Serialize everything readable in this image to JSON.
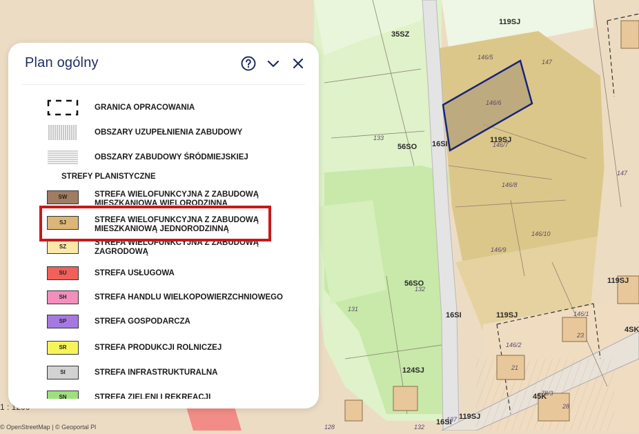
{
  "panel": {
    "title": "Plan ogólny",
    "help_icon": "help-circle-icon",
    "collapse_icon": "chevron-down-icon",
    "close_icon": "close-icon"
  },
  "legend": {
    "items": [
      {
        "label": "GRANICA OPRACOWANIA",
        "symbol": "dashed-boundary"
      },
      {
        "label": "OBSZARY UZUPEŁNIENIA ZABUDOWY",
        "symbol": "vertical-hatch"
      },
      {
        "label": "OBSZARY ZABUDOWY ŚRÓDMIEJSKIEJ",
        "symbol": "horizontal-hatch"
      }
    ],
    "section_header": "STREFY PLANISTYCZNE",
    "zones": [
      {
        "code": "SW",
        "label_line1": "STREFA WIELOFUNKCYJNA Z ZABUDOWĄ",
        "label_line2": "MIESZKANIOWĄ WIELORODZINNĄ",
        "color": "#a07c63"
      },
      {
        "code": "SJ",
        "label_line1": "STREFA WIELOFUNKCYJNA Z ZABUDOWĄ",
        "label_line2": "MIESZKANIOWĄ JEDNORODZINNĄ",
        "color": "#dcb577"
      },
      {
        "code": "SZ",
        "label_line1": "STREFA WIELOFUNKCYJNA Z ZABUDOWĄ",
        "label_line2": "ZAGRODOWĄ",
        "color": "#fbe8a6"
      },
      {
        "code": "SU",
        "label_line1": "STREFA USŁUGOWA",
        "label_line2": "",
        "color": "#f2605a"
      },
      {
        "code": "SH",
        "label_line1": "STREFA HANDLU WIELKOPOWIERZCHNIOWEGO",
        "label_line2": "",
        "color": "#f38fbd"
      },
      {
        "code": "SP",
        "label_line1": "STREFA GOSPODARCZA",
        "label_line2": "",
        "color": "#a678e2"
      },
      {
        "code": "SR",
        "label_line1": "STREFA PRODUKCJI ROLNICZEJ",
        "label_line2": "",
        "color": "#f7f45a"
      },
      {
        "code": "SI",
        "label_line1": "STREFA INFRASTRUKTURALNA",
        "label_line2": "",
        "color": "#d2d2d2"
      },
      {
        "code": "SN",
        "label_line1": "STREFA ZIELENI I REKREACJI",
        "label_line2": "",
        "color": "#9ee07c"
      }
    ],
    "highlighted_code": "SJ"
  },
  "map": {
    "zone_labels": [
      "35SZ",
      "119SJ",
      "56SO",
      "16SI",
      "119SJ",
      "56SO",
      "16SI",
      "119SJ",
      "119SJ",
      "124SJ",
      "4SK",
      "45K",
      "16SI",
      "119SJ"
    ],
    "parcel_labels": [
      "146/5",
      "147",
      "146/6",
      "146/7",
      "133",
      "147",
      "146/8",
      "146/10",
      "146/9",
      "132",
      "131",
      "146/1",
      "23",
      "146/2",
      "21",
      "28",
      "128",
      "132",
      "137",
      "78/3"
    ],
    "scale_text": "1 : 1200",
    "attribution": "© OpenStreetMap | © Geoportal Pl"
  }
}
